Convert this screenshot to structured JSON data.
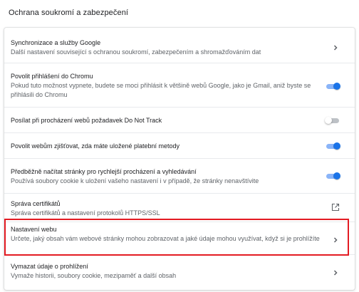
{
  "section_title": "Ochrana soukromí a zabezpečení",
  "highlight_color": "#e31b23",
  "accent_color": "#1a73e8",
  "rows": [
    {
      "label": "Synchronizace a služby Google",
      "sub": "Další nastavení související s ochranou soukromí, zabezpečením a shromažďováním dat",
      "control": "chevron-right-icon"
    },
    {
      "label": "Povolit přihlášení do Chromu",
      "sub": "Pokud tuto možnost vypnete, budete se moci přihlásit k většině webů Google, jako je Gmail, aniž byste se přihlásili do Chromu",
      "control": "toggle",
      "enabled": true
    },
    {
      "label": "Posílat při procházení webů požadavek Do Not Track",
      "control": "toggle",
      "enabled": false
    },
    {
      "label": "Povolit webům zjišťovat, zda máte uložené platební metody",
      "control": "toggle",
      "enabled": true
    },
    {
      "label": "Předběžně načítat stránky pro rychlejší procházení a vyhledávání",
      "sub": "Používá soubory cookie k uložení vašeho nastavení i v případě, že stránky nenavštívite",
      "control": "toggle",
      "enabled": true
    },
    {
      "label": "Správa certifikátů",
      "sub": "Správa certifikátů a nastavení protokolů HTTPS/SSL",
      "control": "external-link-icon"
    },
    {
      "label": "Nastavení webu",
      "sub": "Určete, jaký obsah vám webové stránky mohou zobrazovat a jaké údaje mohou využívat, když si je prohlížíte",
      "control": "chevron-right-icon",
      "highlighted": true
    },
    {
      "label": "Vymazat údaje o prohlížení",
      "sub": "Vymaže historii, soubory cookie, mezipaměť a další obsah",
      "control": "chevron-right-icon"
    }
  ]
}
